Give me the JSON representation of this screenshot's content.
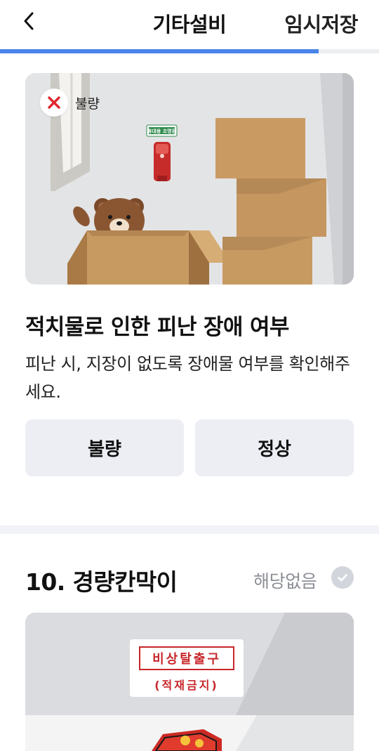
{
  "header": {
    "title": "기타설비",
    "save_label": "임시저장",
    "progress": 0.84
  },
  "question": {
    "badge": {
      "icon": "x-icon",
      "label": "불량"
    },
    "illustration": {
      "sign_text": "휴대용 조명등"
    },
    "title": "적치물로 인한 피난 장애 여부",
    "description": "피난 시, 지장이 없도록 장애물 여부를 확인해주세요.",
    "options": {
      "bad": "불량",
      "good": "정상"
    }
  },
  "section": {
    "title": "10. 경량칸막이",
    "not_applicable_label": "해당없음",
    "illustration": {
      "sign_title": "비상탈출구",
      "sign_subtitle": "(적재금지)"
    }
  },
  "colors": {
    "accent": "#4b84ea",
    "error": "#e0262e",
    "button_bg": "#eceef3"
  }
}
